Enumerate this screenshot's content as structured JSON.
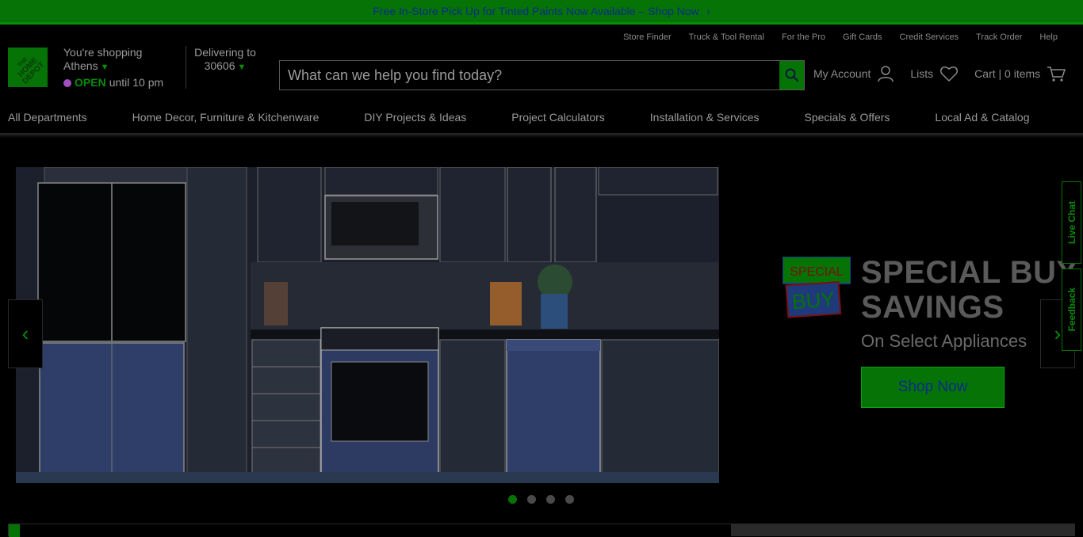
{
  "promo_bar": {
    "text": "Free In-Store Pick Up for Tinted Paints Now Available – Shop Now",
    "chevron": "›"
  },
  "logo": {
    "alt": "THE HOME DEPOT",
    "icon": "home-depot-logo"
  },
  "store": {
    "label": "You're shopping",
    "name": "Athens",
    "status": "OPEN",
    "hours": "until 10 pm"
  },
  "delivery": {
    "label": "Delivering to",
    "zip": "30606"
  },
  "utility_nav": [
    "Store Finder",
    "Truck & Tool Rental",
    "For the Pro",
    "Gift Cards",
    "Credit Services",
    "Track Order",
    "Help"
  ],
  "search": {
    "placeholder": "What can we help you find today?",
    "icon": "search-icon"
  },
  "header_actions": {
    "account": "My Account",
    "lists": "Lists",
    "cart": "Cart | 0 items"
  },
  "main_nav": [
    "All Departments",
    "Home Decor, Furniture & Kitchenware",
    "DIY Projects & Ideas",
    "Project Calculators",
    "Installation & Services",
    "Specials & Offers",
    "Local Ad & Catalog"
  ],
  "hero": {
    "badge_top": "SPECIAL",
    "badge_bottom": "BUY",
    "title_line1": "SPECIAL BUY",
    "title_line2": "SAVINGS",
    "subtitle": "On Select Appliances",
    "cta": "Shop Now",
    "slides_total": 4,
    "active_slide": 1
  },
  "side_tabs": {
    "live_chat": "Live Chat",
    "feedback": "Feedback"
  },
  "colors": {
    "brand_green": "#067306",
    "text": "#9a9a9a",
    "background": "#000000"
  }
}
